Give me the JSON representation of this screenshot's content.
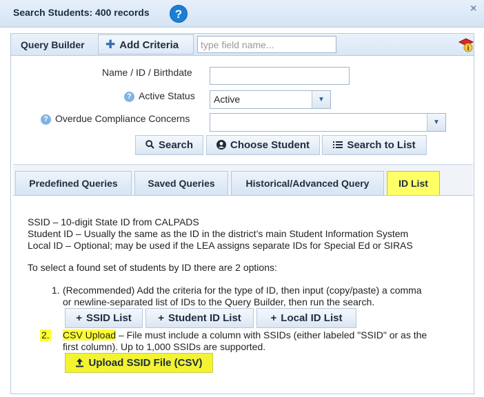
{
  "dialog": {
    "title": "Search Students: 400 records",
    "help_glyph": "?",
    "close_glyph": "×"
  },
  "query_builder": {
    "title": "Query Builder",
    "add_criteria_label": "Add Criteria",
    "field_search_placeholder": "type field name..."
  },
  "criteria": {
    "name_label": "Name / ID / Birthdate",
    "name_value": "",
    "active_status_label": "Active Status",
    "active_status_value": "Active",
    "overdue_label": "Overdue Compliance Concerns",
    "overdue_value": ""
  },
  "actions": {
    "search_label": "Search",
    "choose_student_label": "Choose Student",
    "search_to_list_label": "Search to List"
  },
  "tabs": [
    {
      "label": "Predefined Queries"
    },
    {
      "label": "Saved Queries"
    },
    {
      "label": "Historical/Advanced Query"
    },
    {
      "label": "ID List"
    }
  ],
  "id_list": {
    "line1": "SSID – 10-digit State ID from CALPADS",
    "line2": "Student ID – Usually the same as the ID in the district’s main Student Information System",
    "line3": "Local ID – Optional; may be used if the LEA assigns separate IDs for Special Ed or SIRAS",
    "intro": "To select a found set of students by ID there are 2 options:",
    "opt1_num": "1.",
    "opt1_line1": "(Recommended) Add the criteria for the type of ID, then input (copy/paste) a comma",
    "opt1_line2": "or newline-separated list of IDs to the Query Builder, then run the search.",
    "ssid_list_label": "SSID List",
    "student_id_list_label": "Student ID List",
    "local_id_list_label": "Local ID List",
    "opt2_num": "2.",
    "opt2_title": "CSV Upload",
    "opt2_line1": " – File must include a column with SSIDs (either labeled \"SSID\" or as the",
    "opt2_line2": "first column). Up to 1,000 SSIDs are supported.",
    "upload_label": "Upload SSID File (CSV)"
  },
  "colors": {
    "highlight": "#ffff33",
    "accent": "#1a7fd4"
  }
}
